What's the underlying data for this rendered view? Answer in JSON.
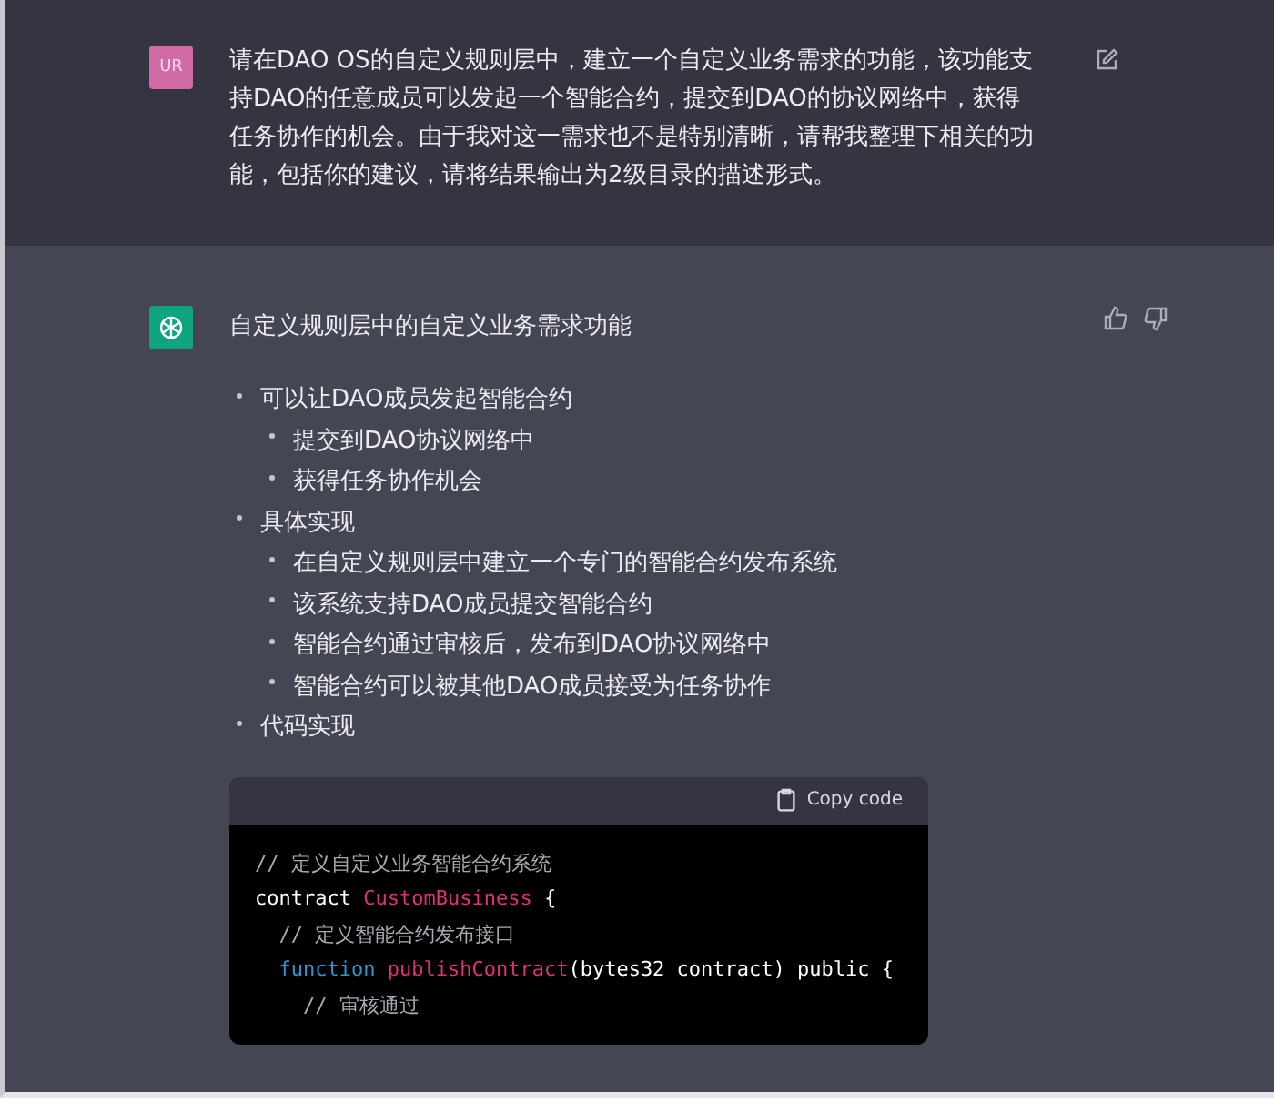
{
  "user_message": {
    "avatar": "UR",
    "text": "请在DAO OS的自定义规则层中，建立一个自定义业务需求的功能，该功能支持DAO的任意成员可以发起一个智能合约，提交到DAO的协议网络中，获得任务协作的机会。由于我对这一需求也不是特别清晰，请帮我整理下相关的功能，包括你的建议，请将结果输出为2级目录的描述形式。"
  },
  "assistant_message": {
    "title": "自定义规则层中的自定义业务需求功能",
    "outline": [
      {
        "text": "可以让DAO成员发起智能合约",
        "children": [
          {
            "text": "提交到DAO协议网络中"
          },
          {
            "text": "获得任务协作机会"
          }
        ]
      },
      {
        "text": "具体实现",
        "children": [
          {
            "text": "在自定义规则层中建立一个专门的智能合约发布系统"
          },
          {
            "text": "该系统支持DAO成员提交智能合约"
          },
          {
            "text": "智能合约通过审核后，发布到DAO协议网络中"
          },
          {
            "text": "智能合约可以被其他DAO成员接受为任务协作"
          }
        ]
      },
      {
        "text": "代码实现"
      }
    ],
    "code_block": {
      "copy_label": "Copy code",
      "lines": [
        [
          {
            "kind": "comment",
            "text": "// 定义自定义业务智能合约系统"
          }
        ],
        [
          {
            "kind": "plain",
            "text": "contract "
          },
          {
            "kind": "name",
            "text": "CustomBusiness"
          },
          {
            "kind": "plain",
            "text": " {"
          }
        ],
        [
          {
            "kind": "comment",
            "text": "  // 定义智能合约发布接口"
          }
        ],
        [
          {
            "kind": "keyword",
            "text": "  function "
          },
          {
            "kind": "name",
            "text": "publishContract"
          },
          {
            "kind": "plain",
            "text": "(bytes32 contract) public {"
          }
        ],
        [
          {
            "kind": "comment",
            "text": "    // 审核通过"
          }
        ]
      ]
    }
  }
}
